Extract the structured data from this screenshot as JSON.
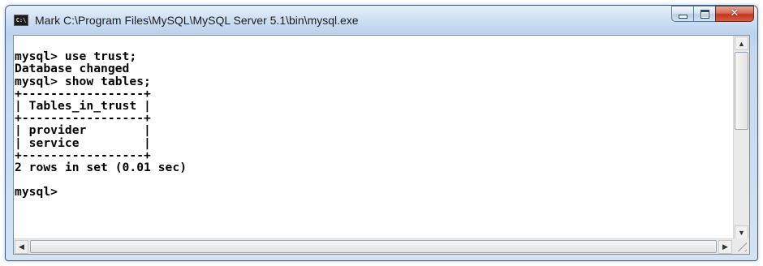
{
  "window": {
    "title": "Mark C:\\Program Files\\MySQL\\MySQL Server 5.1\\bin\\mysql.exe",
    "icon": "console-icon",
    "icon_text": "C:\\"
  },
  "controls": {
    "minimize": "minimize-icon",
    "maximize": "maximize-icon",
    "close": "close-icon",
    "close_glyph": "✕"
  },
  "console": {
    "lines": [
      "",
      "mysql> use trust;",
      "Database changed",
      "mysql> show tables;",
      "+-----------------+",
      "| Tables_in_trust |",
      "+-----------------+",
      "| provider        |",
      "| service         |",
      "+-----------------+",
      "2 rows in set (0.01 sec)",
      "",
      "mysql>"
    ]
  },
  "scrollbars": {
    "up_arrow": "▲",
    "down_arrow": "▼",
    "left_arrow": "◀",
    "right_arrow": "▶"
  }
}
